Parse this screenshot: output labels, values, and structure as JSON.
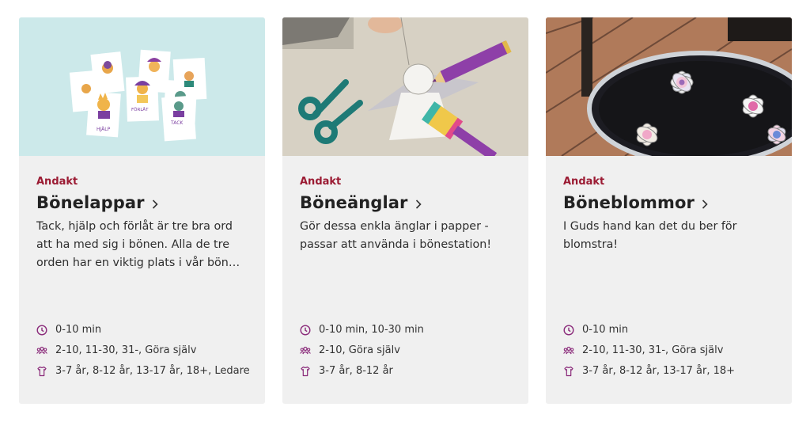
{
  "cards": [
    {
      "category": "Andakt",
      "title": "Bönelappar",
      "description": "Tack, hjälp och förlåt är tre bra ord att ha med sig i bönen. Alla de tre orden har en viktig plats i vår bön och relation till Gud.",
      "time": "0-10 min",
      "group_size": "2-10, 11-30, 31-, Göra själv",
      "ages": "3-7 år, 8-12 år, 13-17 år, 18+, Ledare",
      "image_labels": [
        "HJÄLP",
        "FÖRLÅT",
        "TACK"
      ]
    },
    {
      "category": "Andakt",
      "title": "Böneänglar",
      "description": "Gör dessa enkla änglar i papper - passar att använda i bönestation!",
      "time": "0-10 min, 10-30 min",
      "group_size": "2-10, Göra själv",
      "ages": "3-7 år, 8-12 år"
    },
    {
      "category": "Andakt",
      "title": "Böneblommor",
      "description": "I Guds hand kan det du ber för blomstra!",
      "time": "0-10 min",
      "group_size": "2-10, 11-30, 31-, Göra själv",
      "ages": "3-7 år, 8-12 år, 13-17 år, 18+"
    }
  ],
  "colors": {
    "category": "#9b1b33",
    "icon": "#8a2a7a",
    "card_bg": "#f0f0f0"
  },
  "icons": {
    "time": "clock-icon",
    "group": "group-icon",
    "age": "shirt-icon",
    "chevron": "chevron-right-icon"
  }
}
